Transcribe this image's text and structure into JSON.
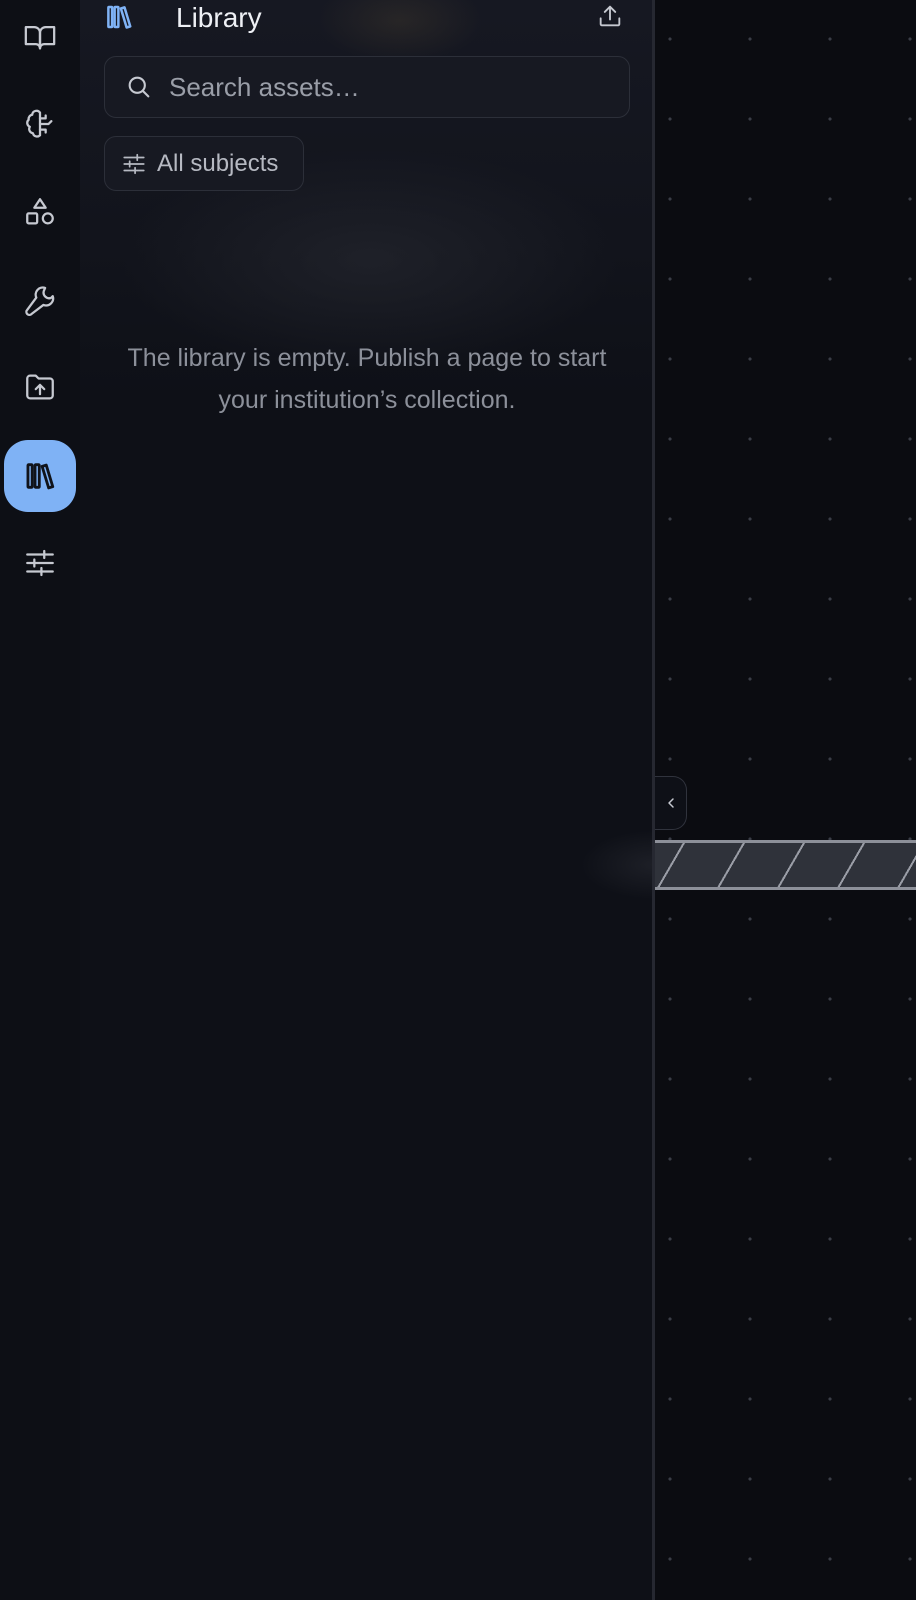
{
  "rail": {
    "items": [
      {
        "icon": "book-open-icon",
        "active": false
      },
      {
        "icon": "brain-icon",
        "active": false
      },
      {
        "icon": "shapes-icon",
        "active": false
      },
      {
        "icon": "wrench-icon",
        "active": false
      },
      {
        "icon": "folder-upload-icon",
        "active": false
      },
      {
        "icon": "library-icon",
        "active": true
      },
      {
        "icon": "sliders-icon",
        "active": false
      }
    ],
    "active_color": "#7fb2f5"
  },
  "panel": {
    "title": "Library",
    "search": {
      "placeholder": "Search assets…",
      "value": ""
    },
    "filter_label": "All subjects",
    "empty_message": "The library is empty. Publish a page to start your institution’s collection."
  },
  "colors": {
    "accent": "#7fb2f5",
    "background": "#0d0f15",
    "text_primary": "#eef0f5",
    "text_muted": "#8c909a"
  }
}
